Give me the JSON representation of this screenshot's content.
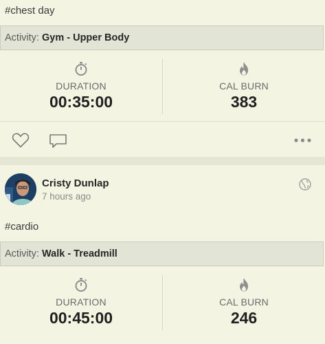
{
  "post1": {
    "hashtag": "#chest day",
    "activity_label": "Activity:",
    "activity_value": "Gym - Upper Body",
    "duration_label": "DURATION",
    "duration_value": "00:35:00",
    "calburn_label": "CAL BURN",
    "calburn_value": "383"
  },
  "post2": {
    "author": "Cristy Dunlap",
    "time_ago": "7 hours ago",
    "hashtag": "#cardio",
    "activity_label": "Activity:",
    "activity_value": "Walk - Treadmill",
    "duration_label": "DURATION",
    "duration_value": "00:45:00",
    "calburn_label": "CAL BURN",
    "calburn_value": "246"
  },
  "icons": {
    "stopwatch": "stopwatch-icon",
    "flame": "flame-icon",
    "heart": "heart-icon",
    "comment": "comment-icon",
    "more": "more-icon",
    "globe": "globe-icon"
  },
  "colors": {
    "background": "#e6e6d4",
    "card": "#f4f4e3",
    "activity_bar": "#e2e4d6",
    "icon_gray": "#8f8f8f"
  }
}
